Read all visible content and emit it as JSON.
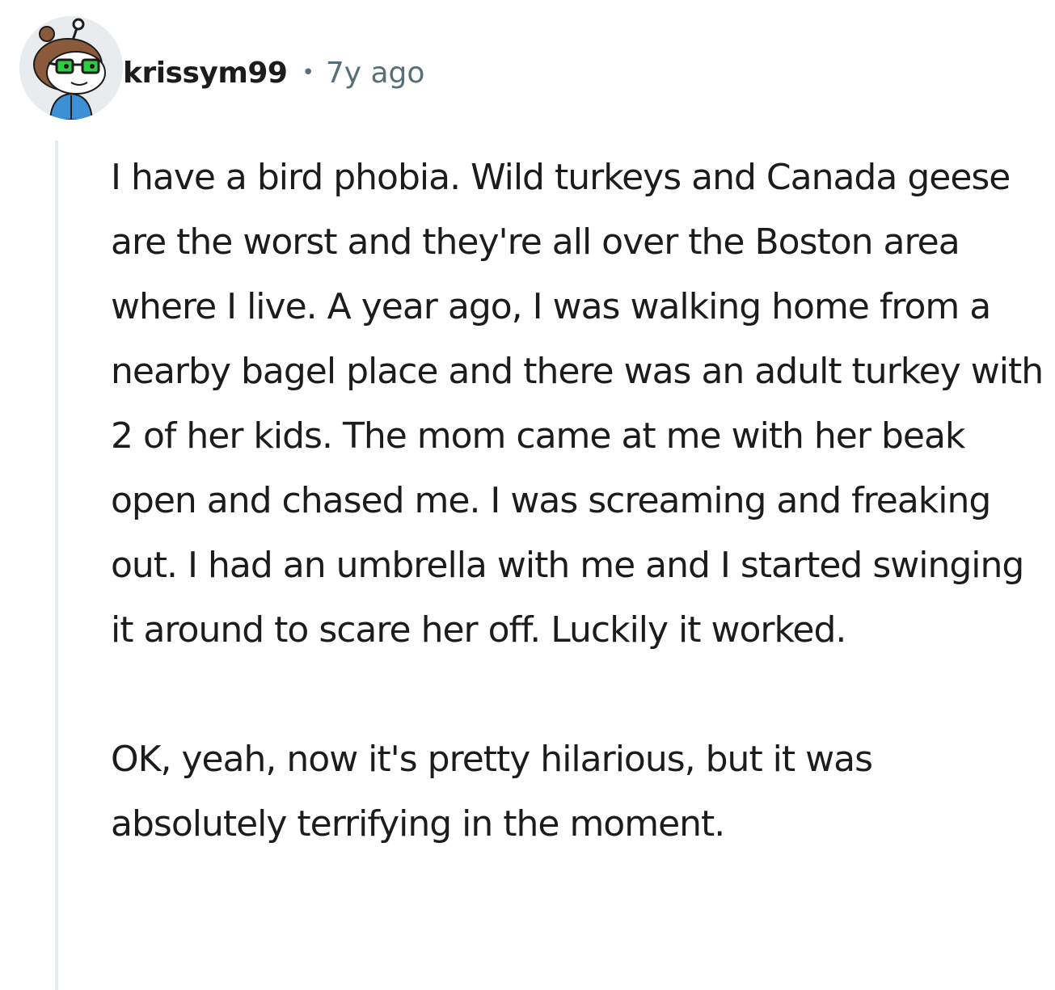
{
  "comment": {
    "username": "krissym99",
    "separator": "•",
    "timestamp": "7y ago",
    "avatar_icon": "reddit-snoo-avatar-glasses",
    "paragraphs": [
      "I have a bird phobia. Wild turkeys and Canada geese are the worst and they're all over the Boston area where I live. A year ago, I was walking home from a nearby bagel place and there was an adult turkey with 2 of her kids. The mom came at me with her beak open and chased me. I was screaming and freaking out. I had an umbrella with me and I started swinging it around to scare her off. Luckily it worked.",
      "OK, yeah, now it's pretty hilarious, but it was absolutely terrifying in the moment."
    ]
  },
  "colors": {
    "text": "#1c1c1c",
    "meta": "#576f76",
    "thread_line": "#e5ebee",
    "avatar_bg": "#e8ecef",
    "glasses": "#2ecc40"
  }
}
